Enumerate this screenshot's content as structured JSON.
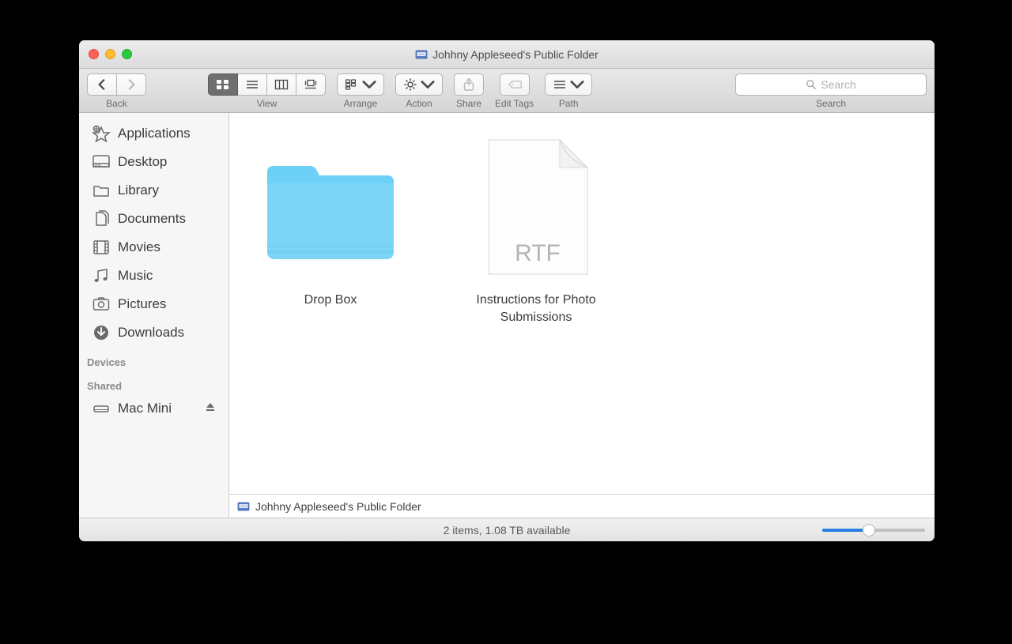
{
  "window": {
    "title": "Johhny Appleseed's Public Folder"
  },
  "toolbar": {
    "back_label": "Back",
    "view_label": "View",
    "arrange_label": "Arrange",
    "action_label": "Action",
    "share_label": "Share",
    "edit_tags_label": "Edit Tags",
    "path_label": "Path",
    "search_label": "Search",
    "search_placeholder": "Search"
  },
  "sidebar": {
    "items": [
      {
        "label": "Applications"
      },
      {
        "label": "Desktop"
      },
      {
        "label": "Library"
      },
      {
        "label": "Documents"
      },
      {
        "label": "Movies"
      },
      {
        "label": "Music"
      },
      {
        "label": "Pictures"
      },
      {
        "label": "Downloads"
      }
    ],
    "devices_header": "Devices",
    "shared_header": "Shared",
    "shared_item": "Mac Mini"
  },
  "items": [
    {
      "name": "Drop Box"
    },
    {
      "name": "Instructions for Photo Submissions"
    }
  ],
  "rtf_badge": "RTF",
  "pathbar": {
    "location": "Johhny Appleseed's Public Folder"
  },
  "statusbar": {
    "text": "2 items, 1.08 TB available"
  },
  "slider": {
    "value": 45
  }
}
